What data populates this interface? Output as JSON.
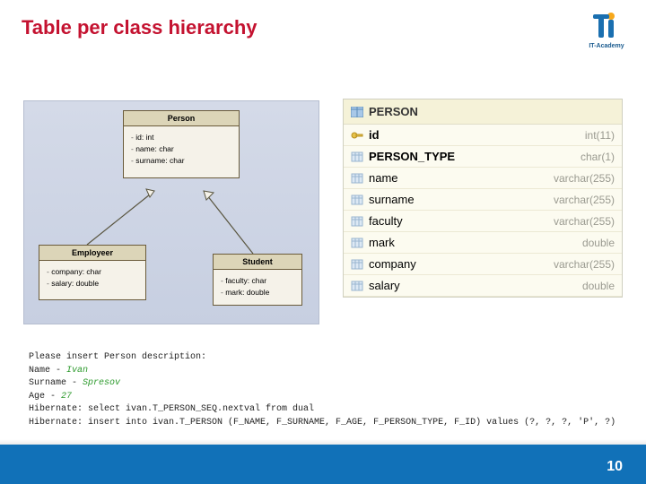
{
  "title": "Table per class hierarchy",
  "logo_text": "IT-Academy",
  "page_number": "10",
  "uml": {
    "person": {
      "name": "Person",
      "fields": [
        "id: int",
        "name: char",
        "surname: char"
      ]
    },
    "employer": {
      "name": "Employeer",
      "fields": [
        "company: char",
        "salary: double"
      ]
    },
    "student": {
      "name": "Student",
      "fields": [
        "faculty: char",
        "mark: double"
      ]
    }
  },
  "db_table": {
    "name": "PERSON",
    "columns": [
      {
        "name": "id",
        "type": "int(11)",
        "pk": true,
        "bold": true
      },
      {
        "name": "PERSON_TYPE",
        "type": "char(1)",
        "bold": true
      },
      {
        "name": "name",
        "type": "varchar(255)"
      },
      {
        "name": "surname",
        "type": "varchar(255)"
      },
      {
        "name": "faculty",
        "type": "varchar(255)"
      },
      {
        "name": "mark",
        "type": "double"
      },
      {
        "name": "company",
        "type": "varchar(255)"
      },
      {
        "name": "salary",
        "type": "double"
      }
    ]
  },
  "console": {
    "l1_a": "Please insert Person description:",
    "l2_a": "Name - ",
    "l2_b": "Ivan",
    "l3_a": "Surname - ",
    "l3_b": "Spresov",
    "l4_a": "Age - ",
    "l4_b": "27",
    "l5": "Hibernate: select ivan.T_PERSON_SEQ.nextval from dual",
    "l6": "Hibernate: insert into ivan.T_PERSON (F_NAME, F_SURNAME, F_AGE, F_PERSON_TYPE, F_ID) values (?, ?, ?, 'P', ?)"
  }
}
